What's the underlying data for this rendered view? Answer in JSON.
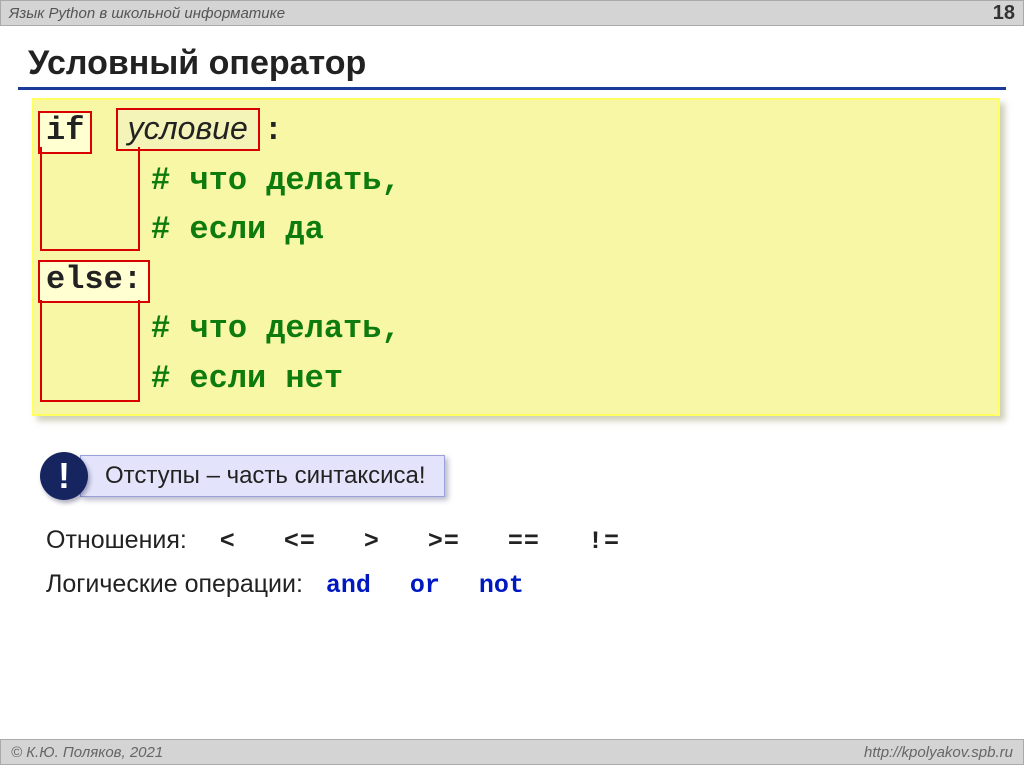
{
  "header": {
    "course_title": "Язык Python в школьной  информатике",
    "page_number": "18"
  },
  "title": "Условный оператор",
  "code": {
    "kw_if": "if",
    "condition_placeholder": "условие",
    "colon": ":",
    "comment_if_1": "# что делать,",
    "comment_if_2": "#            если да",
    "kw_else": "else:",
    "comment_else_1": "# что делать,",
    "comment_else_2": "#            если нет"
  },
  "note": {
    "mark": "!",
    "text": "Отступы – часть синтаксиса!"
  },
  "relations": {
    "label": "Отношения:",
    "ops": [
      "<",
      "<=",
      ">",
      ">=",
      "==",
      "!="
    ]
  },
  "logic": {
    "label": "Логические операции:",
    "ops": [
      "and",
      "or",
      "not"
    ]
  },
  "footer": {
    "copyright": "© К.Ю. Поляков, 2021",
    "url": "http://kpolyakov.spb.ru"
  }
}
